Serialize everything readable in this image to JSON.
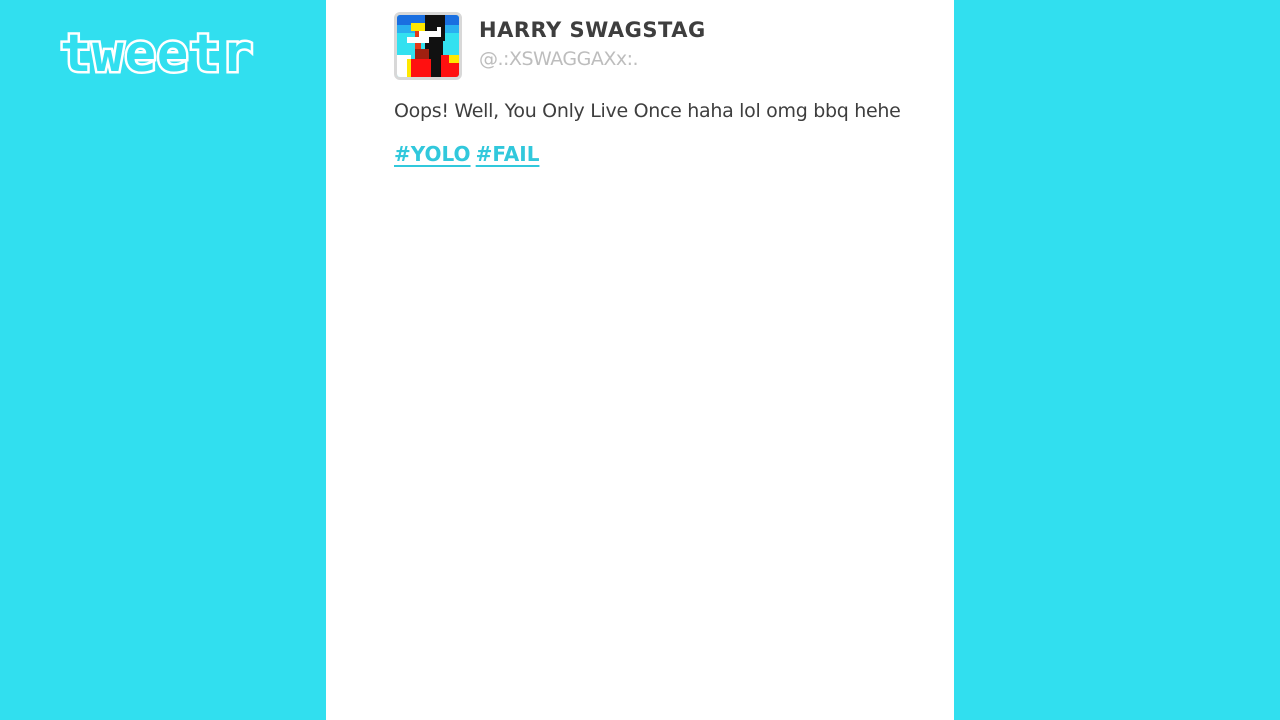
{
  "app": {
    "logo_text": "tweetr"
  },
  "tweet": {
    "author_name": "HARRY SWAGSTAG",
    "author_handle": "@.:XSWAGGAXx:.",
    "text": "Oops! Well, You Only Live Once haha lol omg bbq hehe",
    "hashtags": [
      "#YOLO",
      "#FAIL"
    ]
  },
  "colors": {
    "background": "#31dfef",
    "panel": "#ffffff",
    "name_text": "#3e3e3e",
    "handle_text": "#bdbdbd",
    "hashtag": "#31c8dc"
  },
  "icons": {
    "avatar": "pixel-portrait-avatar"
  }
}
